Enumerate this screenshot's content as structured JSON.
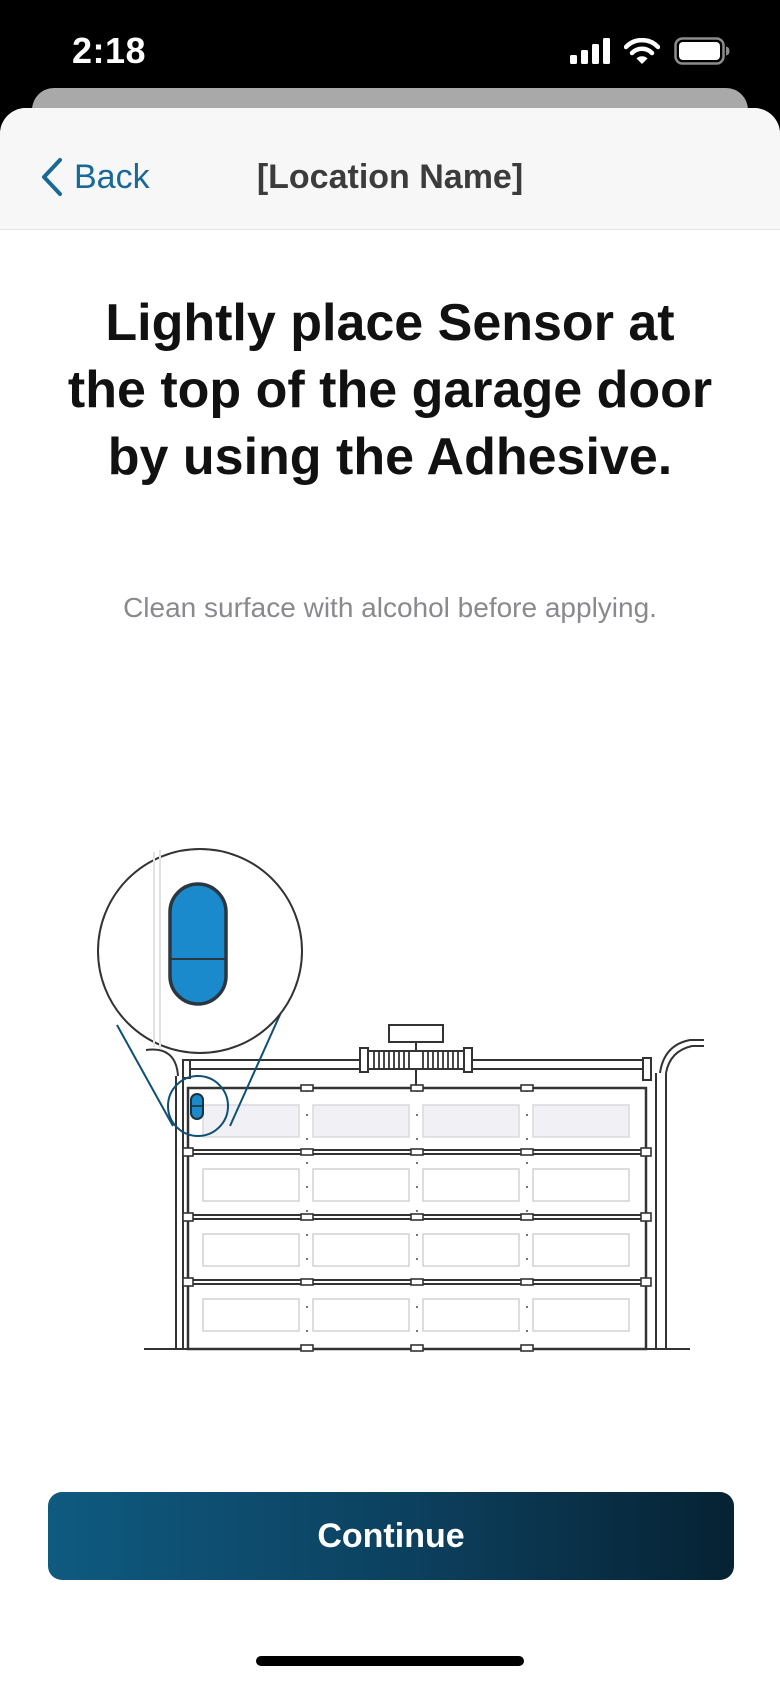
{
  "status_bar": {
    "time": "2:18",
    "icons": [
      "cellular-signal-icon",
      "wifi-icon",
      "battery-icon"
    ]
  },
  "nav": {
    "back_label": "Back",
    "back_icon": "chevron-left-icon",
    "title": "[Location Name]"
  },
  "content": {
    "headline": "Lightly place Sensor at the top of the garage door by using the Adhesive.",
    "subtitle": "Clean surface with alcohol before applying."
  },
  "illustration": {
    "subject": "garage-door-with-sensor-callout",
    "door_panel_rows": 4,
    "door_panel_columns": 4
  },
  "actions": {
    "continue_label": "Continue"
  },
  "colors": {
    "accent": "#1a6896",
    "sensor_blue": "#1a8acd",
    "button_gradient_start": "#0f5a80",
    "button_gradient_end": "#062233",
    "headline": "#111111",
    "subtitle": "#8a8a8e"
  }
}
